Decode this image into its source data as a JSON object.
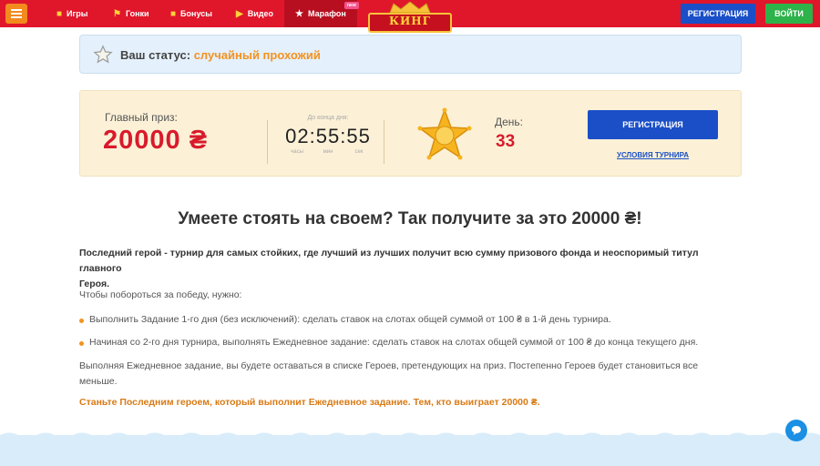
{
  "nav": {
    "items": [
      {
        "label": "Игры",
        "icon": "dice-icon"
      },
      {
        "label": "Гонки",
        "icon": "flag-icon"
      },
      {
        "label": "Бонусы",
        "icon": "gift-icon"
      },
      {
        "label": "Видео",
        "icon": "video-icon"
      },
      {
        "label": "Марафон",
        "icon": "star-icon",
        "badge": "new"
      }
    ],
    "logo_text": "КИНГ",
    "register_label": "РЕГИСТРАЦИЯ",
    "login_label": "ВОЙТИ"
  },
  "status": {
    "label": "Ваш статус:",
    "value": "случайный прохожий"
  },
  "tournament": {
    "prize_label": "Главный приз:",
    "prize_value": "20000 ₴",
    "timer_caption": "До конца дня:",
    "timer_value": "02:55:55",
    "timer_units": [
      "часы",
      "мин",
      "сек"
    ],
    "day_label": "День:",
    "day_value": "33",
    "register_label": "РЕГИСТРАЦИЯ",
    "terms_label": "УСЛОВИЯ ТУРНИРА"
  },
  "content": {
    "heading": "Умеете стоять на своем? Так получите за это 20000 ₴!",
    "intro_line1": "Последний герой - турнир для самых стойких, где лучший из лучших получит всю сумму призового фонда и неоспоримый титул главного",
    "intro_line2": "Героя.",
    "lead": "Чтобы побороться за победу, нужно:",
    "bullets": [
      "Выполнить Задание 1-го дня (без исключений): сделать ставок на слотах общей суммой от 100 ₴ в 1-й день турнира.",
      "Начиная со 2-го дня турнира, выполнять Ежедневное задание: сделать ставок на слотах общей суммой от 100 ₴ до конца текущего дня."
    ],
    "info_line1": "Выполняя Ежедневное задание, вы будете оставаться в списке Героев, претендующих на приз. Постепенно Героев будет становиться все",
    "info_line2": "меньше.",
    "call_to_action": "Станьте Последним героем, который выполнит Ежедневное задание. Тем, кто выиграет 20000 ₴."
  },
  "colors": {
    "topbar": "#e0162b",
    "accent_blue": "#1a4fc7",
    "accent_green": "#2db34a",
    "prize_red": "#d81b2c",
    "status_orange": "#f3921f",
    "panel_bg": "#fcf1d7"
  }
}
